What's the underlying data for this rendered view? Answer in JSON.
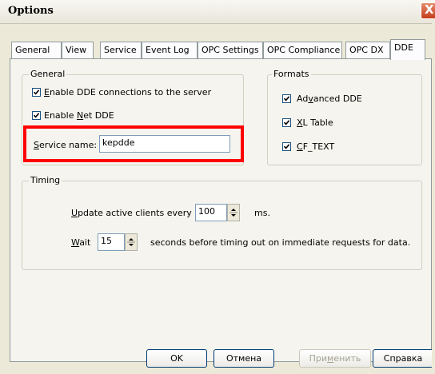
{
  "window": {
    "title": "Options",
    "close_label": "X"
  },
  "tabs": [
    {
      "label": "General",
      "active": false
    },
    {
      "label": "View",
      "active": false
    },
    {
      "label": "Service",
      "active": false
    },
    {
      "label": "Event Log",
      "active": false
    },
    {
      "label": "OPC Settings",
      "active": false
    },
    {
      "label": "OPC Compliance",
      "active": false
    },
    {
      "label": "OPC DX",
      "active": false
    },
    {
      "label": "DDE",
      "active": true
    }
  ],
  "general_group": {
    "legend": "General",
    "enable_dde": {
      "label_pre": "",
      "label_u": "E",
      "label_post": "nable DDE connections to the server",
      "checked": true
    },
    "enable_netdde": {
      "label_pre": "Enable ",
      "label_u": "N",
      "label_post": "et DDE",
      "checked": true
    },
    "service_name": {
      "label_pre": "",
      "label_u": "S",
      "label_post": "ervice name:",
      "value": "kepdde"
    }
  },
  "formats_group": {
    "legend": "Formats",
    "advanced_dde": {
      "label_pre": "Ad",
      "label_u": "v",
      "label_post": "anced DDE",
      "checked": true
    },
    "xl_table": {
      "label_pre": "",
      "label_u": "X",
      "label_post": "L Table",
      "checked": true
    },
    "cf_text": {
      "label_pre": "",
      "label_u": "C",
      "label_post": "F_TEXT",
      "checked": true
    }
  },
  "timing_group": {
    "legend": "Timing",
    "update": {
      "label_pre": "",
      "label_u": "U",
      "label_post": "pdate active clients every",
      "value": "100",
      "unit": "ms."
    },
    "wait": {
      "label_pre": "",
      "label_u": "W",
      "label_post": "ait",
      "value": "15",
      "suffix": "seconds before timing out on immediate requests for data."
    }
  },
  "buttons": {
    "ok": "OK",
    "cancel": "Отмена",
    "apply_pre": "При",
    "apply_u": "м",
    "apply_post": "енить",
    "help": "Справка"
  },
  "colors": {
    "highlight": "#ff0000",
    "close_button": "#c43f1c"
  }
}
